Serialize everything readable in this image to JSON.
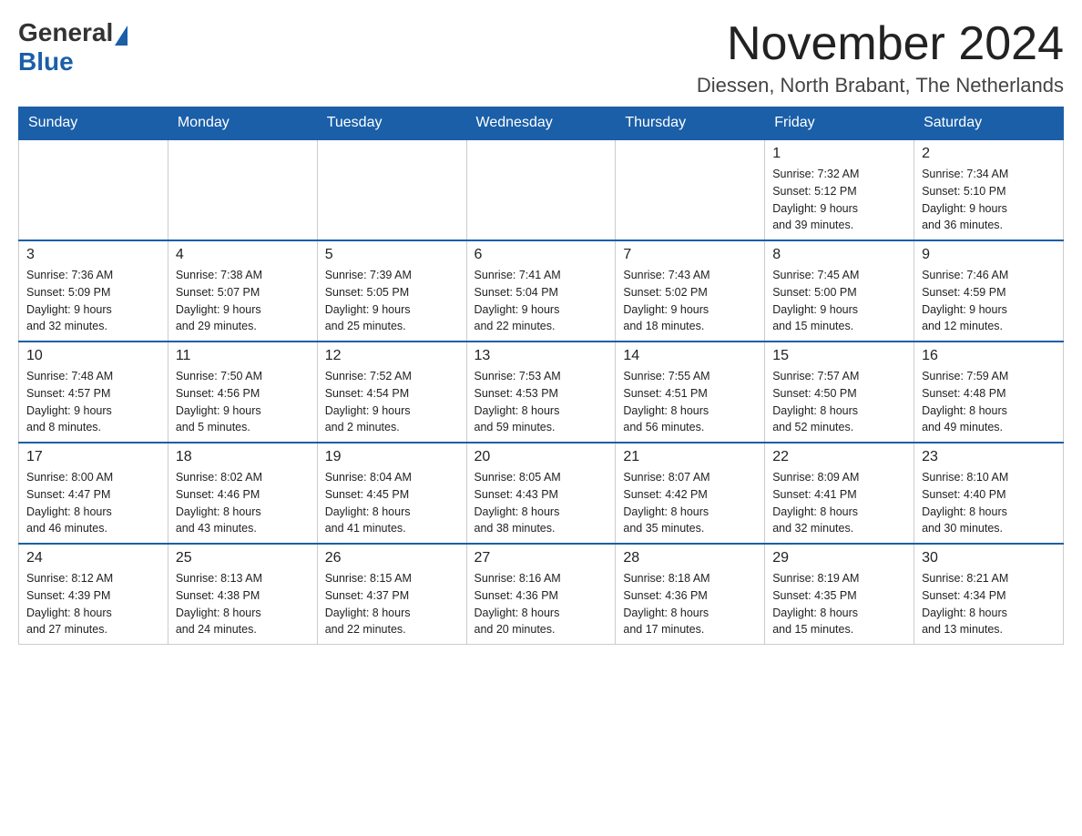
{
  "header": {
    "logo_general": "General",
    "logo_blue": "Blue",
    "month_title": "November 2024",
    "location": "Diessen, North Brabant, The Netherlands"
  },
  "weekdays": [
    "Sunday",
    "Monday",
    "Tuesday",
    "Wednesday",
    "Thursday",
    "Friday",
    "Saturday"
  ],
  "weeks": [
    [
      {
        "day": "",
        "info": ""
      },
      {
        "day": "",
        "info": ""
      },
      {
        "day": "",
        "info": ""
      },
      {
        "day": "",
        "info": ""
      },
      {
        "day": "",
        "info": ""
      },
      {
        "day": "1",
        "info": "Sunrise: 7:32 AM\nSunset: 5:12 PM\nDaylight: 9 hours\nand 39 minutes."
      },
      {
        "day": "2",
        "info": "Sunrise: 7:34 AM\nSunset: 5:10 PM\nDaylight: 9 hours\nand 36 minutes."
      }
    ],
    [
      {
        "day": "3",
        "info": "Sunrise: 7:36 AM\nSunset: 5:09 PM\nDaylight: 9 hours\nand 32 minutes."
      },
      {
        "day": "4",
        "info": "Sunrise: 7:38 AM\nSunset: 5:07 PM\nDaylight: 9 hours\nand 29 minutes."
      },
      {
        "day": "5",
        "info": "Sunrise: 7:39 AM\nSunset: 5:05 PM\nDaylight: 9 hours\nand 25 minutes."
      },
      {
        "day": "6",
        "info": "Sunrise: 7:41 AM\nSunset: 5:04 PM\nDaylight: 9 hours\nand 22 minutes."
      },
      {
        "day": "7",
        "info": "Sunrise: 7:43 AM\nSunset: 5:02 PM\nDaylight: 9 hours\nand 18 minutes."
      },
      {
        "day": "8",
        "info": "Sunrise: 7:45 AM\nSunset: 5:00 PM\nDaylight: 9 hours\nand 15 minutes."
      },
      {
        "day": "9",
        "info": "Sunrise: 7:46 AM\nSunset: 4:59 PM\nDaylight: 9 hours\nand 12 minutes."
      }
    ],
    [
      {
        "day": "10",
        "info": "Sunrise: 7:48 AM\nSunset: 4:57 PM\nDaylight: 9 hours\nand 8 minutes."
      },
      {
        "day": "11",
        "info": "Sunrise: 7:50 AM\nSunset: 4:56 PM\nDaylight: 9 hours\nand 5 minutes."
      },
      {
        "day": "12",
        "info": "Sunrise: 7:52 AM\nSunset: 4:54 PM\nDaylight: 9 hours\nand 2 minutes."
      },
      {
        "day": "13",
        "info": "Sunrise: 7:53 AM\nSunset: 4:53 PM\nDaylight: 8 hours\nand 59 minutes."
      },
      {
        "day": "14",
        "info": "Sunrise: 7:55 AM\nSunset: 4:51 PM\nDaylight: 8 hours\nand 56 minutes."
      },
      {
        "day": "15",
        "info": "Sunrise: 7:57 AM\nSunset: 4:50 PM\nDaylight: 8 hours\nand 52 minutes."
      },
      {
        "day": "16",
        "info": "Sunrise: 7:59 AM\nSunset: 4:48 PM\nDaylight: 8 hours\nand 49 minutes."
      }
    ],
    [
      {
        "day": "17",
        "info": "Sunrise: 8:00 AM\nSunset: 4:47 PM\nDaylight: 8 hours\nand 46 minutes."
      },
      {
        "day": "18",
        "info": "Sunrise: 8:02 AM\nSunset: 4:46 PM\nDaylight: 8 hours\nand 43 minutes."
      },
      {
        "day": "19",
        "info": "Sunrise: 8:04 AM\nSunset: 4:45 PM\nDaylight: 8 hours\nand 41 minutes."
      },
      {
        "day": "20",
        "info": "Sunrise: 8:05 AM\nSunset: 4:43 PM\nDaylight: 8 hours\nand 38 minutes."
      },
      {
        "day": "21",
        "info": "Sunrise: 8:07 AM\nSunset: 4:42 PM\nDaylight: 8 hours\nand 35 minutes."
      },
      {
        "day": "22",
        "info": "Sunrise: 8:09 AM\nSunset: 4:41 PM\nDaylight: 8 hours\nand 32 minutes."
      },
      {
        "day": "23",
        "info": "Sunrise: 8:10 AM\nSunset: 4:40 PM\nDaylight: 8 hours\nand 30 minutes."
      }
    ],
    [
      {
        "day": "24",
        "info": "Sunrise: 8:12 AM\nSunset: 4:39 PM\nDaylight: 8 hours\nand 27 minutes."
      },
      {
        "day": "25",
        "info": "Sunrise: 8:13 AM\nSunset: 4:38 PM\nDaylight: 8 hours\nand 24 minutes."
      },
      {
        "day": "26",
        "info": "Sunrise: 8:15 AM\nSunset: 4:37 PM\nDaylight: 8 hours\nand 22 minutes."
      },
      {
        "day": "27",
        "info": "Sunrise: 8:16 AM\nSunset: 4:36 PM\nDaylight: 8 hours\nand 20 minutes."
      },
      {
        "day": "28",
        "info": "Sunrise: 8:18 AM\nSunset: 4:36 PM\nDaylight: 8 hours\nand 17 minutes."
      },
      {
        "day": "29",
        "info": "Sunrise: 8:19 AM\nSunset: 4:35 PM\nDaylight: 8 hours\nand 15 minutes."
      },
      {
        "day": "30",
        "info": "Sunrise: 8:21 AM\nSunset: 4:34 PM\nDaylight: 8 hours\nand 13 minutes."
      }
    ]
  ]
}
